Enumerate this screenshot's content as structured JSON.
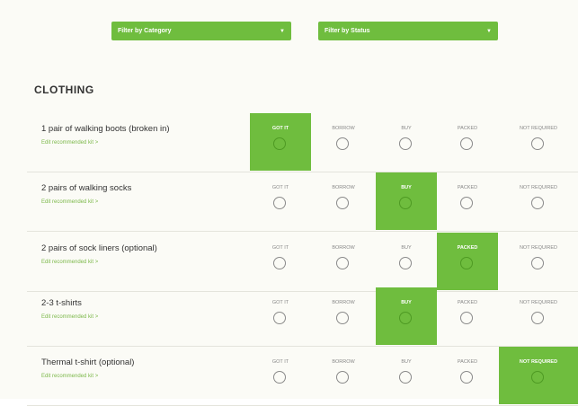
{
  "filters": {
    "category_label": "Filter by Category",
    "status_label": "Filter by Status"
  },
  "section": {
    "title": "CLOTHING"
  },
  "statuses": [
    "GOT IT",
    "BORROW",
    "BUY",
    "PACKED",
    "NOT REQUIRED"
  ],
  "items": [
    {
      "name": "1 pair of walking boots (broken in)",
      "edit": "Edit recommended kit >",
      "selected": 0
    },
    {
      "name": "2 pairs of walking socks",
      "edit": "Edit recommended kit >",
      "selected": 2
    },
    {
      "name": "2 pairs of sock liners (optional)",
      "edit": "Edit recommended kit >",
      "selected": 3
    },
    {
      "name": "2-3 t-shirts",
      "edit": "Edit recommended kit >",
      "selected": 2
    },
    {
      "name": "Thermal t-shirt (optional)",
      "edit": "Edit recommended kit >",
      "selected": 4
    }
  ],
  "colors": {
    "accent": "#6fbd3e",
    "link": "#7cb84a",
    "background": "#fbfbf6"
  },
  "icons": {
    "dropdown": "chevron-down-icon",
    "radio": "radio-circle-icon"
  }
}
